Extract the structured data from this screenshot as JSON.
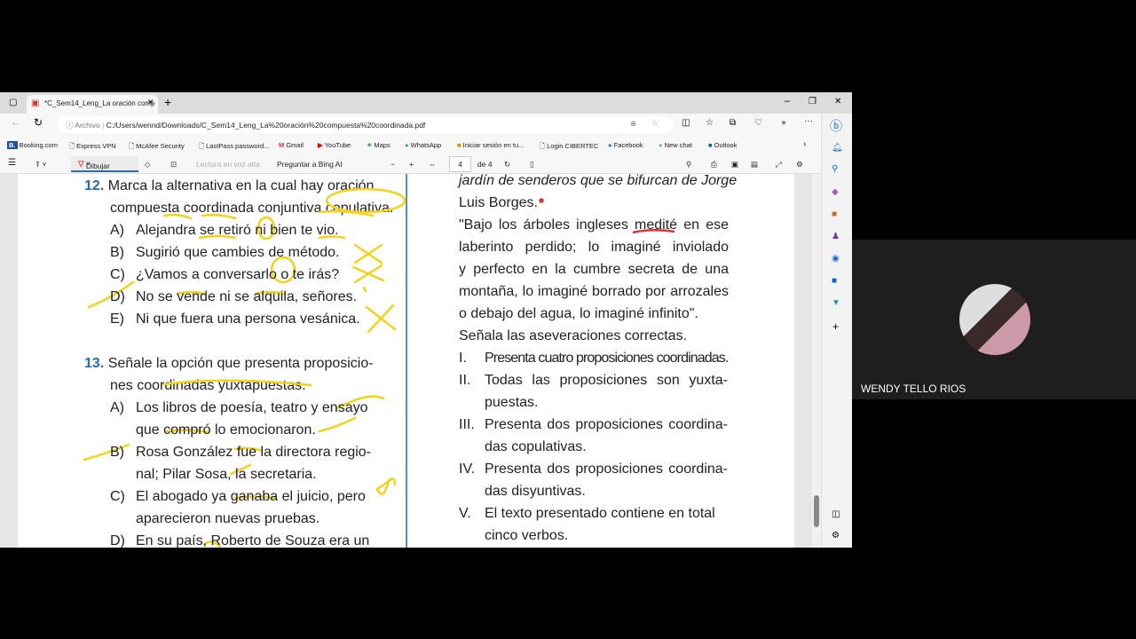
{
  "browser": {
    "tab_title": "*C_Sem14_Leng_La oración comp",
    "url_prefix": "Archivo",
    "url": "C:/Users/wennd/Downloads/C_Sem14_Leng_La%20oración%20compuesta%20coordinada.pdf"
  },
  "bookmarks": [
    "Booking.com",
    "Express VPN",
    "McAfee Security",
    "LastPass password...",
    "Gmail",
    "YouTube",
    "Maps",
    "WhatsApp",
    "Iniciar sesión en tu...",
    "Login CIBERTEC",
    "Facebook",
    "New chat",
    "Outlook"
  ],
  "pdf_toolbar": {
    "draw": "Dibujar",
    "read_aloud": "Lectura en voz alta",
    "ask_bing": "Preguntar a Bing AI",
    "page": "4",
    "of": "de 4"
  },
  "left": {
    "q12_num": "12.",
    "q12_l1": "Marca la alternativa en la cual hay oración",
    "q12_l2": "compuesta coordinada conjuntiva copulativa.",
    "q12_opts": [
      [
        "A)",
        "Alejandra se retiró ni bien te vio."
      ],
      [
        "B)",
        "Sugirió que cambies de método."
      ],
      [
        "C)",
        "¿Vamos a conversarlo o te irás?"
      ],
      [
        "D)",
        "No se vende ni se alquila, señores."
      ],
      [
        "E)",
        "Ni que fuera una persona vesánica."
      ]
    ],
    "q13_num": "13.",
    "q13_l1": "Señale la opción que presenta proposicio-",
    "q13_l2": "nes coordinadas yuxtapuestas.",
    "q13_lines": [
      [
        "A)",
        "Los libros de poesía, teatro y ensayo"
      ],
      [
        "",
        "que compró lo emocionaron."
      ],
      [
        "B)",
        "Rosa González fue la directora regio-"
      ],
      [
        "",
        "nal; Pilar Sosa, la secretaria."
      ],
      [
        "C)",
        "El abogado ya ganaba el juicio, pero"
      ],
      [
        "",
        "aparecieron nuevas pruebas."
      ],
      [
        "D)",
        "En su país, Roberto de Souza era un"
      ]
    ]
  },
  "right": {
    "lines": [
      "jardín de senderos que se bifurcan de Jorge",
      "Luis Borges.",
      "\"Bajo los árboles ingleses medité en ese",
      "laberinto perdido; lo imaginé inviolado",
      "y perfecto en la cumbre secreta de una",
      "montaña, lo imaginé borrado por arrozales",
      "o debajo del agua, lo imaginé infinito\".",
      "Señala las aseveraciones correctas."
    ],
    "options": [
      [
        "I.",
        "Presenta cuatro proposiciones coordinadas."
      ],
      [
        "II.",
        "Todas las proposiciones son yuxta-"
      ],
      [
        "",
        "puestas."
      ],
      [
        "III.",
        "Presenta dos proposiciones coordina-"
      ],
      [
        "",
        "das copulativas."
      ],
      [
        "IV.",
        "Presenta dos proposiciones coordina-"
      ],
      [
        "",
        "das disyuntivas."
      ],
      [
        "V.",
        "El texto presentado contiene en total"
      ],
      [
        "",
        "cinco verbos."
      ]
    ]
  },
  "participant": {
    "name": "WENDY TELLO RIOS"
  }
}
